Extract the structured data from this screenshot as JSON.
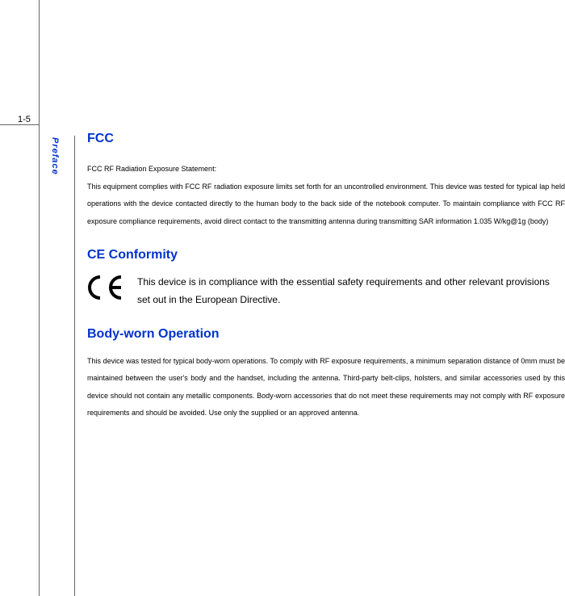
{
  "page_number": "1-5",
  "sidebar_label": "Preface",
  "sections": {
    "fcc": {
      "heading": "FCC",
      "statement_label": "FCC RF Radiation Exposure Statement:",
      "body": "This equipment complies with FCC RF radiation exposure limits set forth for an uncontrolled environment. This device was tested for typical lap held operations with the device contacted directly to the human body to the back side of the notebook computer. To maintain compliance with FCC RF exposure compliance requirements, avoid direct contact to the transmitting antenna during transmitting SAR information 1.035 W/kg@1g (body)"
    },
    "ce": {
      "heading": "CE Conformity",
      "body": "This device is in compliance with the essential safety requirements and other relevant provisions set out in the European Directive."
    },
    "bodyworn": {
      "heading": "Body-worn Operation",
      "body": "This device was tested for typical body-worn operations. To comply with RF exposure requirements, a minimum separation distance of 0mm must be maintained between the user's body and the handset, including the antenna. Third-party belt-clips, holsters, and similar accessories used by this device should not contain any metallic components. Body-worn accessories that do not meet these requirements may not comply with RF exposure requirements and should be avoided. Use only the supplied or an approved antenna."
    }
  }
}
